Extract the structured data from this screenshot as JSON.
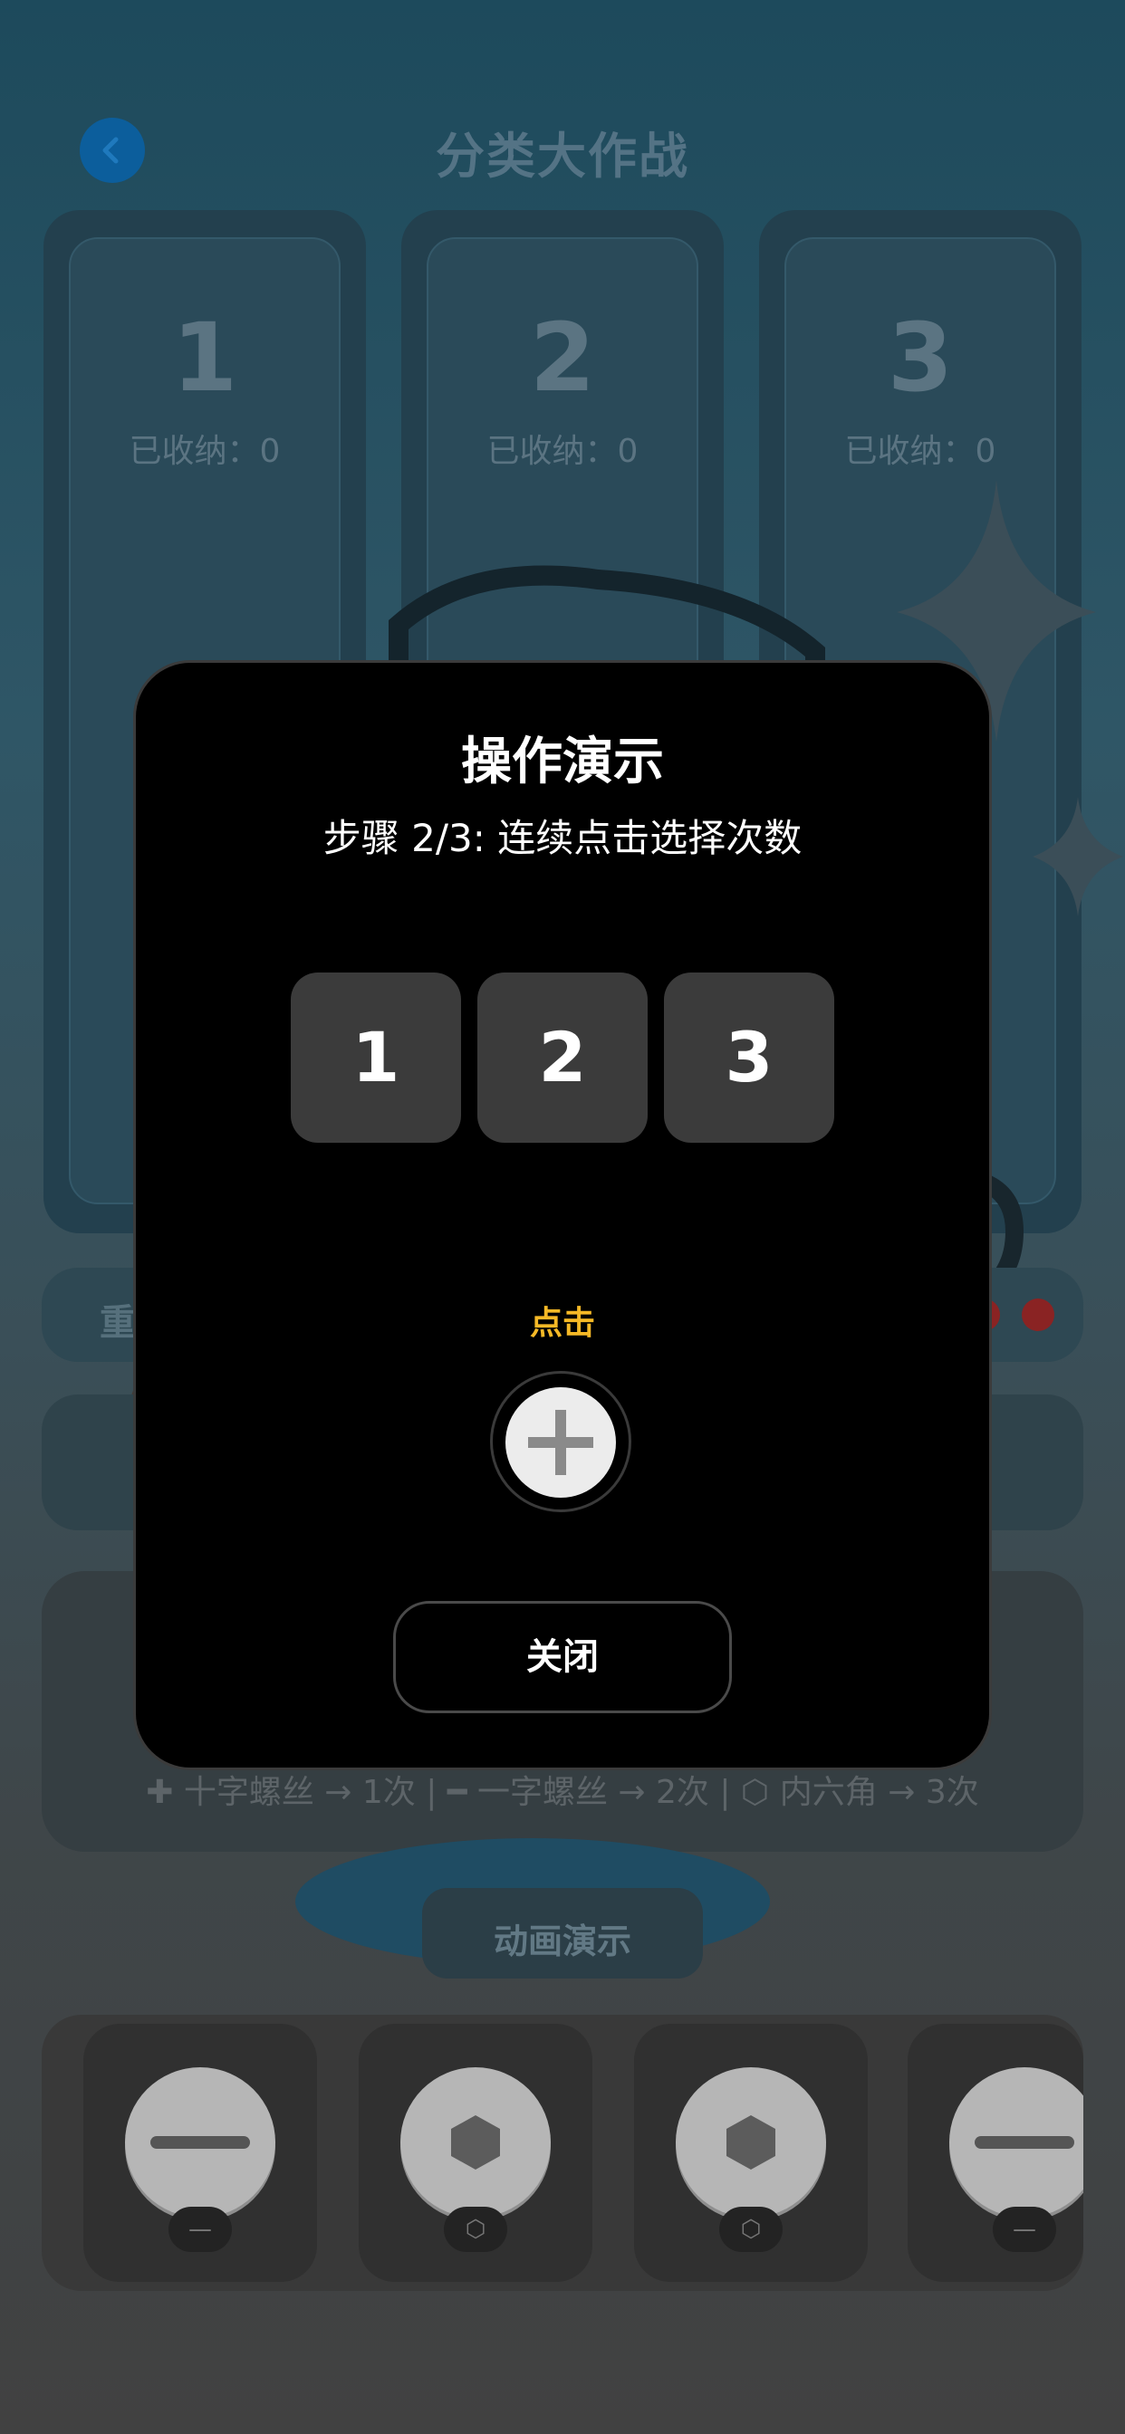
{
  "header": {
    "title": "分类大作战",
    "back_icon": "chevron-left-icon"
  },
  "bins": [
    {
      "number": "1",
      "count_label": "已收纳：0"
    },
    {
      "number": "2",
      "count_label": "已收纳：0"
    },
    {
      "number": "3",
      "count_label": "已收纳：0"
    }
  ],
  "status_bar": {
    "label": "重"
  },
  "legend_hint": "✚ 十字螺丝 → 1次 | ━ 一字螺丝 → 2次 | ⬡ 内六角 → 3次",
  "demo_button_label": "动画演示",
  "screw_tray": [
    {
      "type": "slotted",
      "chip": "—"
    },
    {
      "type": "hex",
      "chip": "⬡"
    },
    {
      "type": "hex",
      "chip": "⬡"
    },
    {
      "type": "slotted",
      "chip": "—"
    }
  ],
  "modal": {
    "title": "操作演示",
    "subtitle": "步骤 2/3: 连续点击选择次数",
    "number_keys": [
      "1",
      "2",
      "3"
    ],
    "tap_label": "点击",
    "tap_icon": "cross-screw-icon",
    "close_label": "关闭"
  },
  "colors": {
    "accent_yellow": "#f6b926",
    "modal_bg": "#000000",
    "back_button": "#0c5e9c"
  }
}
